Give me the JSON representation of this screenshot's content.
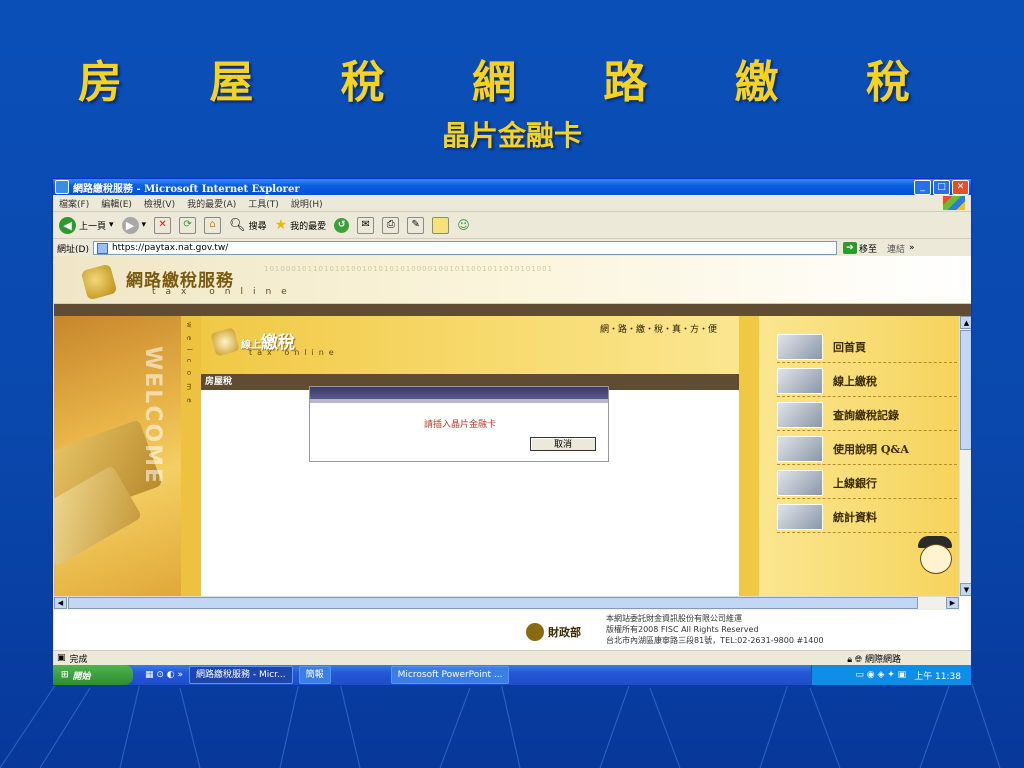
{
  "slide": {
    "title": "房 屋 稅 網 路 繳 稅",
    "subtitle": "晶片金融卡"
  },
  "window": {
    "title": "網路繳稅服務 - Microsoft Internet Explorer",
    "menu": [
      "檔案(F)",
      "編輯(E)",
      "檢視(V)",
      "我的最愛(A)",
      "工具(T)",
      "說明(H)"
    ],
    "toolbar": {
      "back": "上一頁",
      "search": "搜尋",
      "favorites": "我的最愛"
    },
    "address_label": "網址(D)",
    "url": "https://paytax.nat.gov.tw/",
    "go": "移至",
    "links": "連結"
  },
  "page": {
    "banner_title": "網路繳稅服務",
    "banner_sub": "tax online",
    "side_vertical": "w e l c o m e",
    "welcome": "WELCOME",
    "head_title_small": "線上",
    "head_title": "繳稅",
    "head_sub": "tax online",
    "slogan": "網・路・繳・稅・真・方・便",
    "tab": "房屋稅",
    "menu": [
      {
        "label": "回首頁"
      },
      {
        "label": "線上繳稅"
      },
      {
        "label": "查詢繳稅記錄"
      },
      {
        "label": "使用說明 Q&A"
      },
      {
        "label": "上線銀行"
      },
      {
        "label": "統計資料"
      }
    ],
    "footer": {
      "ministry": "財政部",
      "line1": "本網站委託財金資訊股份有限公司維運",
      "line2": "版權所有2008 FISC All Rights Reserved",
      "line3": "台北市內湖區康寧路三段81號，TEL:02-2631-9800 #1400"
    }
  },
  "dialog": {
    "message": "請插入晶片金融卡",
    "cancel": "取消"
  },
  "status": {
    "done": "完成",
    "zone": "網際網路"
  },
  "taskbar": {
    "start": "開始",
    "tasks": [
      "網路繳稅服務 - Micr...",
      "簡報",
      "Microsoft PowerPoint ..."
    ],
    "clock": "上午 11:38"
  },
  "colors": {
    "slide_bg": "#0a4fb8",
    "title_gold": "#f7d21e",
    "dialog_text": "#c0392b"
  }
}
